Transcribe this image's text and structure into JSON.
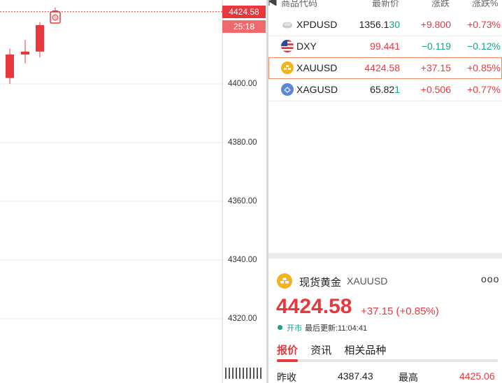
{
  "chart": {
    "last_price_tag": "4424.58",
    "countdown_tag": "25:18",
    "axis_ticks": [
      "4400.00",
      "4380.00",
      "4360.00",
      "4340.00",
      "4320.00"
    ],
    "price_ylim": [
      4315,
      4428
    ],
    "tick_values": [
      4400,
      4380,
      4360,
      4340,
      4320
    ],
    "current_price": 4424.58,
    "candles": [
      {
        "open": 4402,
        "close": 4410,
        "high": 4412,
        "low": 4400
      },
      {
        "open": 4410,
        "close": 4411,
        "high": 4415,
        "low": 4407
      },
      {
        "open": 4411,
        "close": 4420,
        "high": 4421,
        "low": 4409
      },
      {
        "open": 4424,
        "close": 4425,
        "high": 4426,
        "low": 4423
      }
    ],
    "colors": {
      "up": "#e8383d",
      "grid": "#e9e9e9",
      "axis_line": "#d4d4d4"
    }
  },
  "watchlist": {
    "headers": {
      "symbol": "商品代码",
      "last": "最新价",
      "change": "涨跌",
      "pct": "涨跌%"
    },
    "rows": [
      {
        "icon": "platinum-bar-icon",
        "symbol": "XPDUSD",
        "last_main": "1356.1",
        "last_tail": "30",
        "change": "+9.800",
        "pct": "+0.73%"
      },
      {
        "icon": "us-flag-icon",
        "symbol": "DXY",
        "last_main": "99.441",
        "last_tail": "",
        "change": "−0.119",
        "pct": "−0.12%"
      },
      {
        "icon": "gold-bar-icon",
        "symbol": "XAUUSD",
        "last_main": "4424.58",
        "last_tail": "",
        "change": "+37.15",
        "pct": "+0.85%"
      },
      {
        "icon": "silver-bar-icon",
        "symbol": "XAGUSD",
        "last_main": "65.82",
        "last_tail": "1",
        "change": "+0.506",
        "pct": "+0.77%"
      }
    ]
  },
  "detail": {
    "icon": "gold-bar-icon",
    "name": "现货黄金",
    "symbol": "XAUUSD",
    "more": "ooo",
    "price": "4424.58",
    "change": "+37.15 (+0.85%)",
    "status_open": "开市",
    "status_update": "最后更新:11:04:41",
    "tabs": [
      "报价",
      "资讯",
      "相关品种"
    ],
    "prev_close_label": "昨收",
    "prev_close_value": "4387.43",
    "high_label": "最高",
    "high_value": "4425.06"
  },
  "colors": {
    "accent_red": "#e8383d",
    "accent_green": "#14a38b",
    "selected_border": "#f08a63",
    "gold": "#f2b321"
  }
}
